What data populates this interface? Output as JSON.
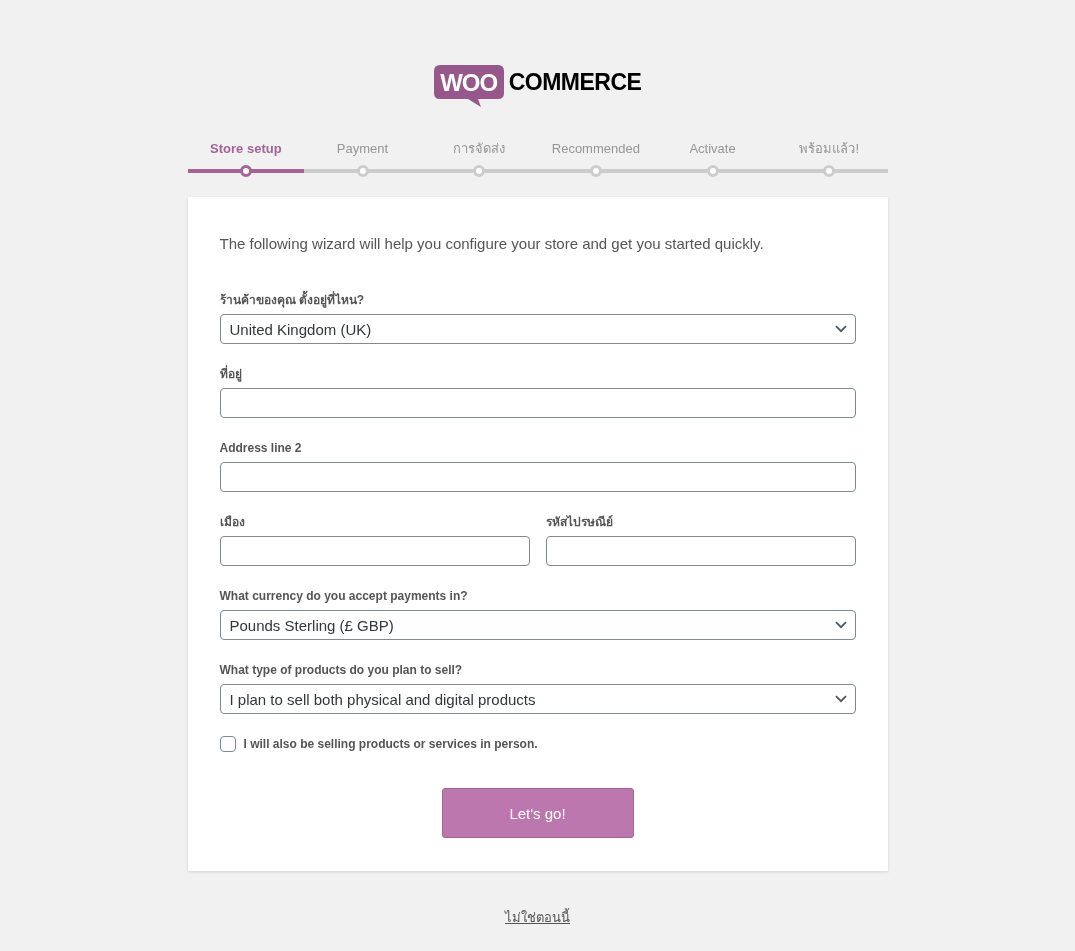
{
  "logo": {
    "badge": "WOO",
    "wordmark": "COMMERCE"
  },
  "steps": [
    {
      "label": "Store setup",
      "active": true
    },
    {
      "label": "Payment",
      "active": false
    },
    {
      "label": "การจัดส่ง",
      "active": false
    },
    {
      "label": "Recommended",
      "active": false
    },
    {
      "label": "Activate",
      "active": false
    },
    {
      "label": "พร้อมแล้ว!",
      "active": false
    }
  ],
  "intro": "The following wizard will help you configure your store and get you started quickly.",
  "fields": [
    {
      "kind": "select",
      "label": "ร้านค้าของคุณ ตั้งอยู่ที่ไหน?",
      "value": "United Kingdom (UK)",
      "half": false
    },
    {
      "kind": "text",
      "label": "ที่อยู่",
      "half": false
    },
    {
      "kind": "text",
      "label": "Address line 2",
      "half": false
    },
    {
      "kind": "text",
      "label": "เมือง",
      "half": true
    },
    {
      "kind": "text",
      "label": "รหัสไปรษณีย์",
      "half": true
    },
    {
      "kind": "select",
      "label": "What currency do you accept payments in?",
      "value": "Pounds Sterling (£ GBP)",
      "half": false
    },
    {
      "kind": "select",
      "label": "What type of products do you plan to sell?",
      "value": "I plan to sell both physical and digital products",
      "half": false
    }
  ],
  "in_person": {
    "label": "I will also be selling products or services in person.",
    "checked": false
  },
  "submit_button": "Let's go!",
  "skip_link": "ไม่ใช่ตอนนี้"
}
